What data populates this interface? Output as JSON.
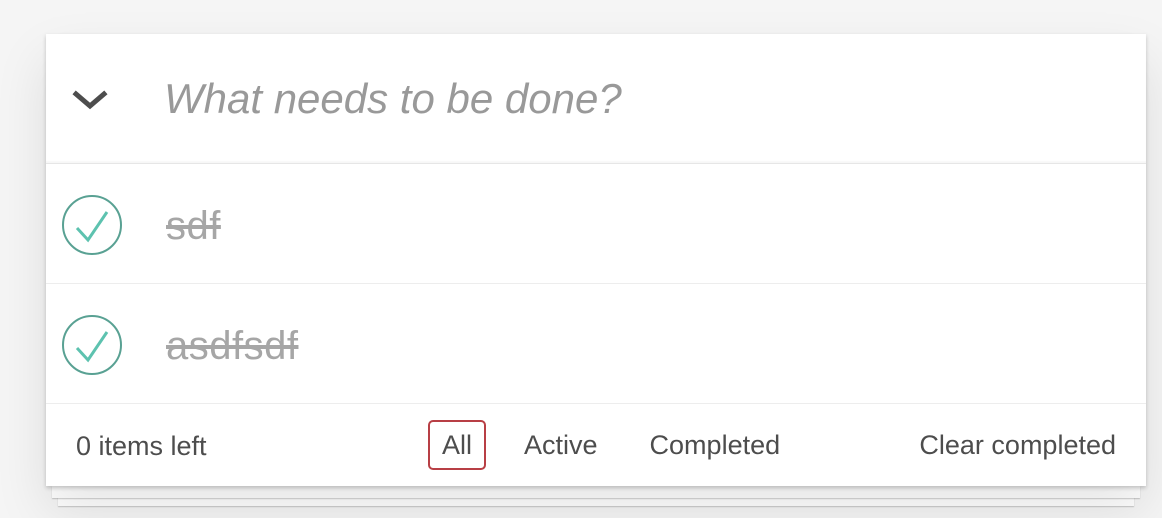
{
  "header": {
    "new_todo_placeholder": "What needs to be done?",
    "toggle_all_icon": "chevron-down-icon"
  },
  "todos": [
    {
      "label": "sdf",
      "completed": true
    },
    {
      "label": "asdfsdf",
      "completed": true
    }
  ],
  "footer": {
    "count_text": "0 items left",
    "filters": [
      {
        "label": "All",
        "selected": true
      },
      {
        "label": "Active",
        "selected": false
      },
      {
        "label": "Completed",
        "selected": false
      }
    ],
    "clear_label": "Clear completed"
  },
  "colors": {
    "accent_red": "#b83f45",
    "check_green": "#5dc2af",
    "check_circle": "#59a193"
  }
}
